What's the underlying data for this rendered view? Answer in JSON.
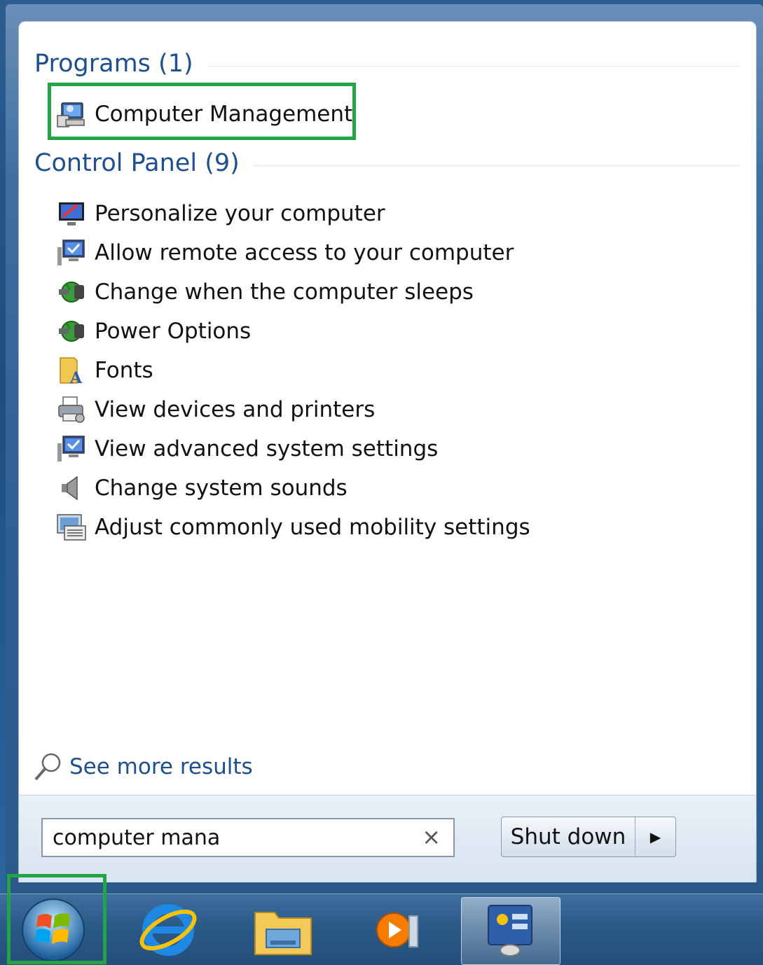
{
  "sections": {
    "programs": {
      "title": "Programs (1)"
    },
    "control_panel": {
      "title": "Control Panel (9)"
    }
  },
  "programs": [
    {
      "label": "Computer Management",
      "icon": "computer-management-icon"
    }
  ],
  "control_panel": [
    {
      "label": "Personalize your computer",
      "icon": "personalize-icon"
    },
    {
      "label": "Allow remote access to your computer",
      "icon": "system-monitor-icon"
    },
    {
      "label": "Change when the computer sleeps",
      "icon": "power-plug-icon"
    },
    {
      "label": "Power Options",
      "icon": "power-plug-icon"
    },
    {
      "label": "Fonts",
      "icon": "fonts-folder-icon"
    },
    {
      "label": "View devices and printers",
      "icon": "printer-icon"
    },
    {
      "label": "View advanced system settings",
      "icon": "system-monitor-icon"
    },
    {
      "label": "Change system sounds",
      "icon": "speaker-icon"
    },
    {
      "label": "Adjust commonly used mobility settings",
      "icon": "mobility-center-icon"
    }
  ],
  "see_more": {
    "label": "See more results"
  },
  "search": {
    "value": "computer mana",
    "clear_glyph": "×"
  },
  "shutdown": {
    "label": "Shut down",
    "arrow_glyph": "▸"
  },
  "taskbar": {
    "items": [
      "start-orb-icon",
      "internet-explorer-icon",
      "windows-explorer-icon",
      "media-player-icon",
      "computer-management-icon"
    ]
  },
  "colors": {
    "header": "#1e4f8e",
    "highlight": "#23a447",
    "taskbar": "#2b5a88"
  }
}
